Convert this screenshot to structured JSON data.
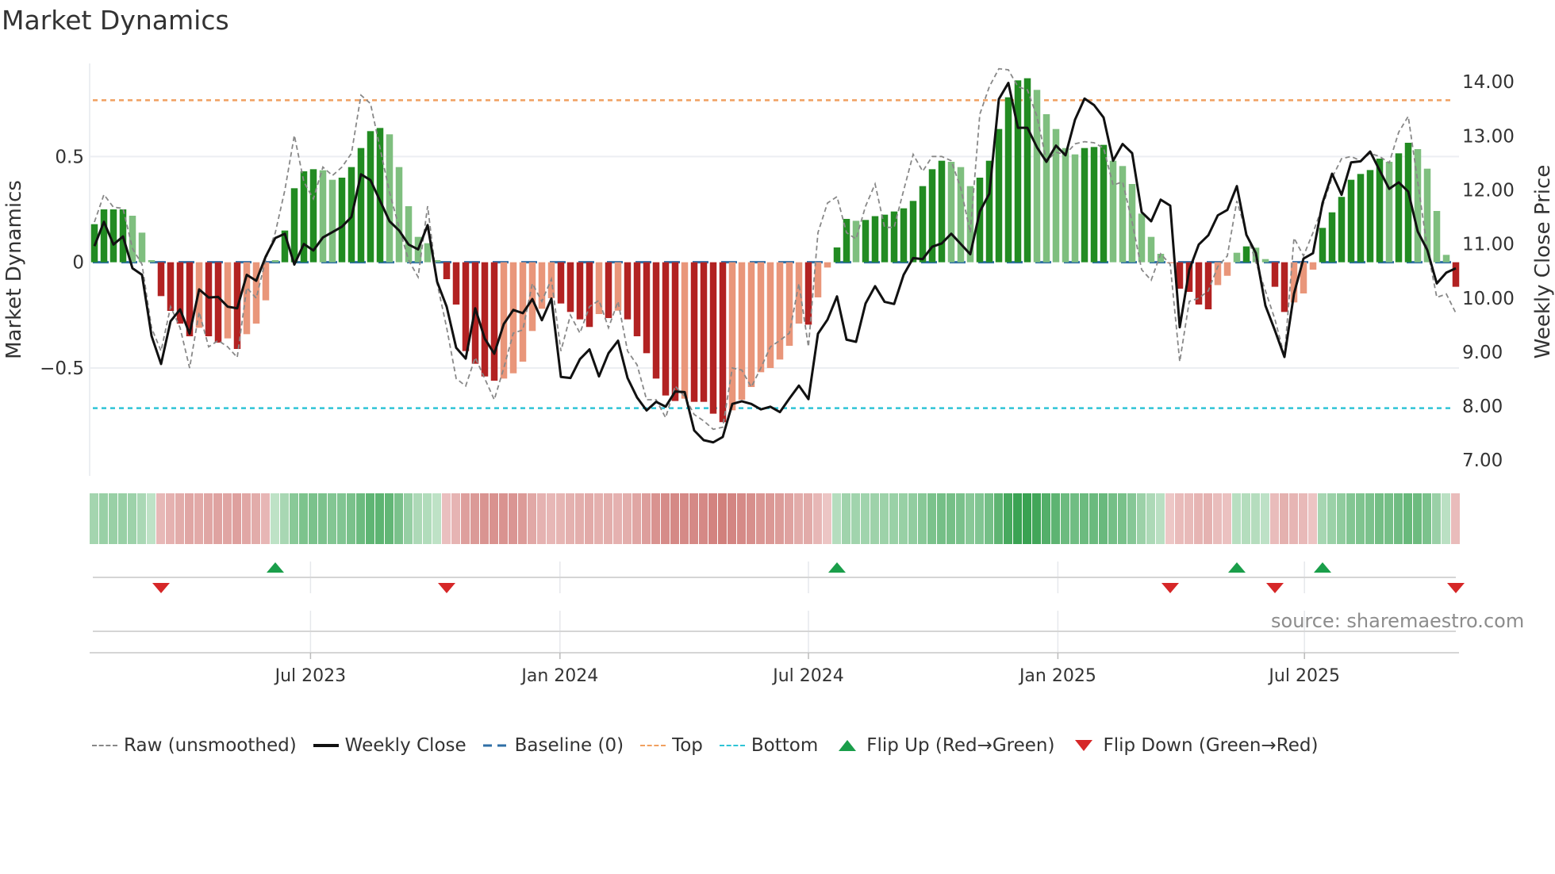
{
  "title": "Market Dynamics",
  "source": "source: sharemaestro.com",
  "colors": {
    "bar_up_strong": "#228b22",
    "bar_up_weak": "#7fbf7f",
    "bar_down_strong": "#b22222",
    "bar_down_weak": "#e9967a",
    "close": "#111111",
    "raw": "#888888",
    "baseline": "#2f6fa6",
    "top": "#f0a060",
    "bottom": "#2ec4d6",
    "flip_up": "#1a9e4a",
    "flip_down": "#d62728"
  },
  "legend": [
    {
      "key": "raw",
      "label": "Raw (unsmoothed)"
    },
    {
      "key": "close",
      "label": "Weekly Close"
    },
    {
      "key": "baseline",
      "label": "Baseline (0)"
    },
    {
      "key": "top",
      "label": "Top"
    },
    {
      "key": "bottom",
      "label": "Bottom"
    },
    {
      "key": "flip_up",
      "label": "Flip Up (Red→Green)"
    },
    {
      "key": "flip_down",
      "label": "Flip Down (Green→Red)"
    }
  ],
  "chart_data": {
    "type": "bar",
    "title": "Market Dynamics",
    "ylabel": "Market Dynamics",
    "y2label": "Weekly Close Price",
    "ylim": [
      -1.01,
      0.94
    ],
    "y2lim": [
      6.71,
      14.34
    ],
    "yticks": [
      {
        "v": 0.5,
        "label": "0.5"
      },
      {
        "v": 0,
        "label": "0"
      },
      {
        "v": -0.5,
        "label": "−0.5"
      }
    ],
    "y2ticks": [
      {
        "v": 14,
        "label": "14.00"
      },
      {
        "v": 13,
        "label": "13.00"
      },
      {
        "v": 12,
        "label": "12.00"
      },
      {
        "v": 11,
        "label": "11.00"
      },
      {
        "v": 10,
        "label": "10.00"
      },
      {
        "v": 9,
        "label": "9.00"
      },
      {
        "v": 8,
        "label": "8.00"
      },
      {
        "v": 7,
        "label": "7.00"
      }
    ],
    "xunit": "week index",
    "xticks": [
      {
        "week": 22.7,
        "label": "Jul 2023"
      },
      {
        "week": 48.9,
        "label": "Jan 2024"
      },
      {
        "week": 75.0,
        "label": "Jul 2024"
      },
      {
        "week": 101.2,
        "label": "Jan 2025"
      },
      {
        "week": 127.1,
        "label": "Jul 2025"
      }
    ],
    "top_level": 0.766,
    "bottom_level": -0.69,
    "baseline": 0,
    "dynamics": [
      0.18,
      0.25,
      0.25,
      0.25,
      0.22,
      0.14,
      0.01,
      -0.16,
      -0.23,
      -0.29,
      -0.35,
      -0.31,
      -0.35,
      -0.38,
      -0.36,
      -0.41,
      -0.34,
      -0.29,
      -0.18,
      0.01,
      0.15,
      0.35,
      0.43,
      0.44,
      0.435,
      0.39,
      0.4,
      0.45,
      0.54,
      0.62,
      0.635,
      0.605,
      0.45,
      0.265,
      0.12,
      0.09,
      0.01,
      -0.08,
      -0.2,
      -0.42,
      -0.48,
      -0.54,
      -0.56,
      -0.55,
      -0.525,
      -0.47,
      -0.325,
      -0.22,
      -0.17,
      -0.195,
      -0.235,
      -0.27,
      -0.306,
      -0.245,
      -0.264,
      -0.229,
      -0.27,
      -0.35,
      -0.43,
      -0.55,
      -0.63,
      -0.656,
      -0.645,
      -0.66,
      -0.66,
      -0.716,
      -0.756,
      -0.7,
      -0.65,
      -0.59,
      -0.52,
      -0.5,
      -0.46,
      -0.395,
      -0.29,
      -0.295,
      -0.166,
      -0.025,
      0.07,
      0.205,
      0.196,
      0.2,
      0.218,
      0.225,
      0.24,
      0.255,
      0.29,
      0.36,
      0.44,
      0.48,
      0.475,
      0.45,
      0.36,
      0.4,
      0.48,
      0.63,
      0.78,
      0.86,
      0.87,
      0.815,
      0.7,
      0.63,
      0.54,
      0.51,
      0.54,
      0.545,
      0.555,
      0.48,
      0.455,
      0.37,
      0.23,
      0.12,
      0.04,
      -0.005,
      -0.125,
      -0.14,
      -0.2,
      -0.2225,
      -0.108,
      -0.064,
      0.045,
      0.075,
      0.069,
      0.015,
      -0.116,
      -0.235,
      -0.19,
      -0.1475,
      -0.035,
      0.1625,
      0.236,
      0.309,
      0.39,
      0.4175,
      0.436,
      0.49,
      0.475,
      0.515,
      0.565,
      0.535,
      0.4425,
      0.2425,
      0.035,
      -0.116
    ],
    "raw": [
      0.19,
      0.32,
      0.26,
      0.255,
      0.065,
      -0.01,
      -0.31,
      -0.42,
      -0.21,
      -0.31,
      -0.5,
      -0.235,
      -0.4,
      -0.37,
      -0.4,
      -0.45,
      -0.12,
      -0.17,
      0.015,
      0.14,
      0.34,
      0.6,
      0.38,
      0.3,
      0.45,
      0.41,
      0.45,
      0.515,
      0.79,
      0.75,
      0.54,
      0.33,
      0.165,
      0.01,
      -0.07,
      0.265,
      -0.1,
      -0.31,
      -0.55,
      -0.585,
      -0.45,
      -0.55,
      -0.65,
      -0.5,
      -0.335,
      -0.32,
      -0.1,
      -0.185,
      -0.08,
      -0.42,
      -0.25,
      -0.335,
      -0.21,
      -0.18,
      -0.31,
      -0.185,
      -0.42,
      -0.485,
      -0.65,
      -0.65,
      -0.735,
      -0.585,
      -0.635,
      -0.72,
      -0.75,
      -0.79,
      -0.78,
      -0.5,
      -0.51,
      -0.59,
      -0.5,
      -0.4,
      -0.37,
      -0.335,
      -0.1,
      -0.4,
      0.14,
      0.28,
      0.31,
      0.14,
      0.11,
      0.265,
      0.37,
      0.165,
      0.165,
      0.34,
      0.51,
      0.43,
      0.5,
      0.5,
      0.48,
      0.35,
      0.14,
      0.7,
      0.83,
      0.915,
      0.91,
      0.83,
      0.815,
      0.69,
      0.48,
      0.52,
      0.51,
      0.56,
      0.57,
      0.565,
      0.54,
      0.365,
      0.38,
      0.19,
      -0.035,
      -0.085,
      0.04,
      -0.01,
      -0.47,
      -0.185,
      -0.17,
      -0.135,
      -0.02,
      0.03,
      0.29,
      0.14,
      0.0,
      -0.135,
      -0.27,
      -0.445,
      0.115,
      0.03,
      0.14,
      0.265,
      0.4,
      0.49,
      0.5,
      0.48,
      0.515,
      0.5,
      0.47,
      0.615,
      0.69,
      0.38,
      0.065,
      -0.166,
      -0.15,
      -0.24
    ],
    "close": [
      10.96,
      11.41,
      10.99,
      11.14,
      10.55,
      10.43,
      9.3,
      8.78,
      9.57,
      9.79,
      9.34,
      10.16,
      10.01,
      10.02,
      9.84,
      9.81,
      10.43,
      10.32,
      10.77,
      11.11,
      11.19,
      10.62,
      11.0,
      10.88,
      11.12,
      11.22,
      11.32,
      11.5,
      12.29,
      12.18,
      11.8,
      11.42,
      11.25,
      10.99,
      10.9,
      11.35,
      10.3,
      9.84,
      9.08,
      8.88,
      9.81,
      9.25,
      8.97,
      9.52,
      9.78,
      9.72,
      9.98,
      9.59,
      9.99,
      8.54,
      8.52,
      8.87,
      9.05,
      8.55,
      8.98,
      9.21,
      8.52,
      8.16,
      7.92,
      8.08,
      7.99,
      8.27,
      8.26,
      7.55,
      7.37,
      7.33,
      7.43,
      8.04,
      8.09,
      8.04,
      7.94,
      7.99,
      7.89,
      8.14,
      8.38,
      8.13,
      9.34,
      9.6,
      10.03,
      9.23,
      9.19,
      9.9,
      10.22,
      9.93,
      9.89,
      10.43,
      10.74,
      10.72,
      10.95,
      11.01,
      11.19,
      11.0,
      10.81,
      11.6,
      11.93,
      13.68,
      13.98,
      13.15,
      13.15,
      12.79,
      12.52,
      12.82,
      12.64,
      13.3,
      13.69,
      13.57,
      13.34,
      12.54,
      12.85,
      12.68,
      11.59,
      11.42,
      11.82,
      11.71,
      9.46,
      10.52,
      10.99,
      11.16,
      11.53,
      11.63,
      12.07,
      11.17,
      10.83,
      9.86,
      9.4,
      8.91,
      10.08,
      10.73,
      10.83,
      11.76,
      12.3,
      11.91,
      12.51,
      12.53,
      12.71,
      12.36,
      12.02,
      12.14,
      11.97,
      11.23,
      10.89,
      10.27,
      10.47,
      10.55
    ],
    "flip_up_weeks": [
      19,
      78,
      120,
      129
    ],
    "flip_down_weeks": [
      7,
      37,
      113,
      124,
      143
    ]
  }
}
